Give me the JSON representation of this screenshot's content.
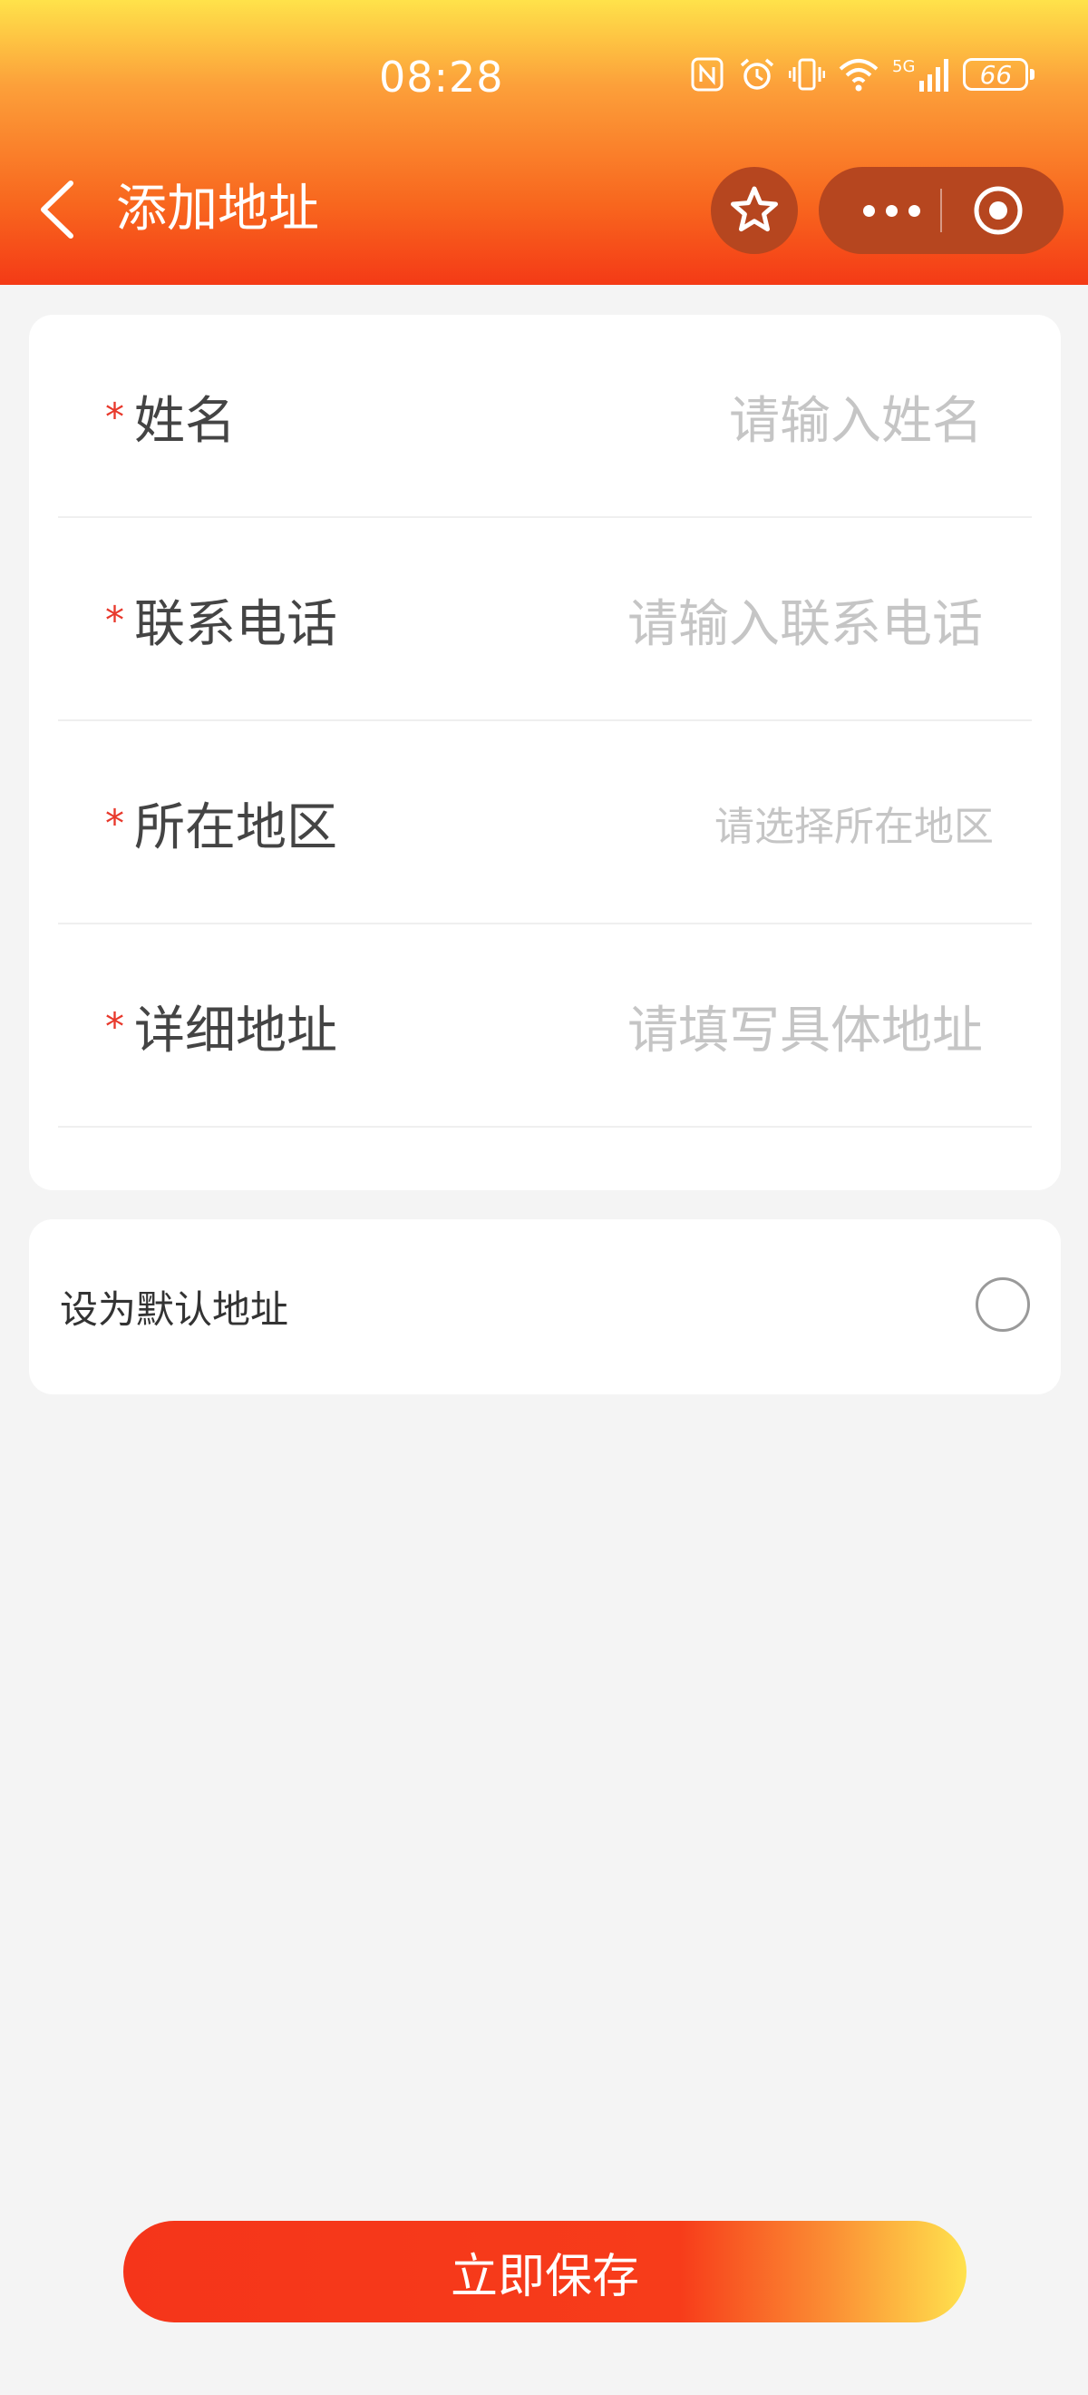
{
  "status_bar": {
    "time": "08:28",
    "battery": "66",
    "network": "5G"
  },
  "nav": {
    "title": "添加地址",
    "back_icon": "chevron-left-icon",
    "favorite_icon": "star-icon",
    "more_icon": "more-dots-icon",
    "close_icon": "target-circle-icon"
  },
  "form": {
    "required_mark": "*",
    "fields": [
      {
        "label": "姓名",
        "placeholder": "请输入姓名"
      },
      {
        "label": "联系电话",
        "placeholder": "请输入联系电话"
      },
      {
        "label": "所在地区",
        "placeholder": "请选择所在地区"
      },
      {
        "label": "详细地址",
        "placeholder": "请填写具体地址"
      }
    ]
  },
  "default_address": {
    "label": "设为默认地址",
    "checked": false
  },
  "actions": {
    "save_label": "立即保存"
  },
  "colors": {
    "primary": "#f43a16",
    "gradient_end": "#ffe24a",
    "required": "#e8392c",
    "placeholder": "#c5c5c5",
    "background": "#f4f4f4"
  }
}
